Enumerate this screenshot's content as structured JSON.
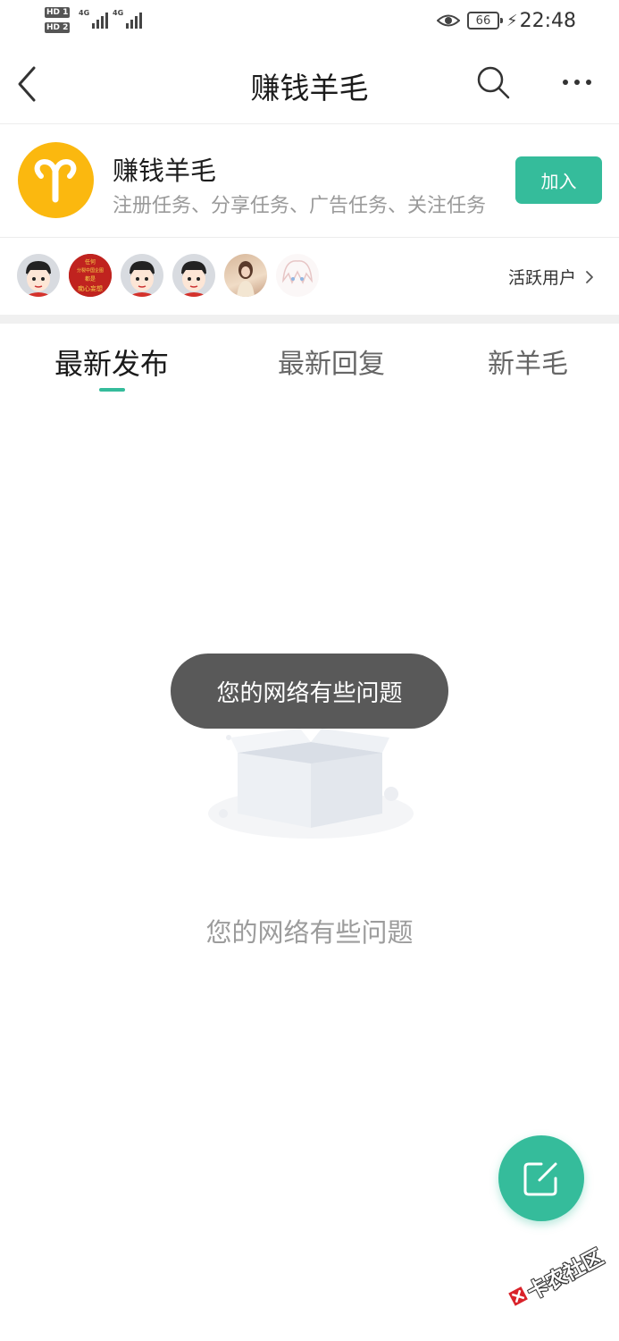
{
  "status_bar": {
    "sim1": "HD 1",
    "sim2": "HD 2",
    "signal1": "4G",
    "signal2": "4G",
    "battery": "66",
    "time": "22:48"
  },
  "nav": {
    "title": "赚钱羊毛"
  },
  "group": {
    "name": "赚钱羊毛",
    "description": "注册任务、分享任务、广告任务、关注任务",
    "join_label": "加入",
    "logo_icon": "aries-icon",
    "logo_color": "#fbb80f"
  },
  "active_users": {
    "label": "活跃用户",
    "avatars": [
      "avatar-cartoon",
      "avatar-red-banner",
      "avatar-cartoon",
      "avatar-cartoon",
      "avatar-photo",
      "avatar-anime"
    ],
    "red_avatar_text": [
      "任何",
      "分裂中国企图",
      "都是",
      "痴心妄想"
    ]
  },
  "tabs": [
    {
      "label": "最新发布",
      "active": true
    },
    {
      "label": "最新回复",
      "active": false
    },
    {
      "label": "新羊毛",
      "active": false
    }
  ],
  "empty_state": {
    "message": "您的网络有些问题"
  },
  "toast": {
    "message": "您的网络有些问题"
  },
  "fab": {
    "icon": "compose-icon"
  },
  "watermark": {
    "text": "卡农社区"
  },
  "colors": {
    "accent": "#35bc9b",
    "logo": "#fbb80f"
  }
}
